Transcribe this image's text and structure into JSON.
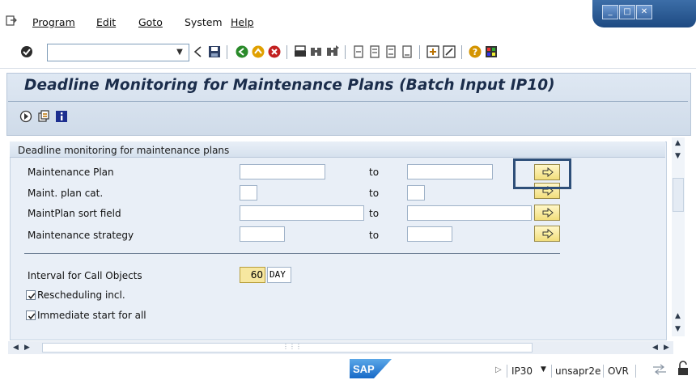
{
  "menu": {
    "items": [
      "Program",
      "Edit",
      "Goto",
      "System",
      "Help"
    ]
  },
  "toolbar": {
    "command_value": "",
    "icons": [
      "enter-icon",
      "back-icon",
      "save-icon",
      "back-green-icon",
      "exit-icon",
      "cancel-icon",
      "print-icon",
      "find-icon",
      "find-next-icon",
      "first-page-icon",
      "previous-page-icon",
      "next-page-icon",
      "last-page-icon",
      "create-session-icon",
      "shortcut-icon",
      "help-icon",
      "customize-layout-icon"
    ]
  },
  "title": {
    "text": "Deadline Monitoring for Maintenance Plans (Batch Input IP10)"
  },
  "app_toolbar": {
    "icons": [
      "execute-icon",
      "get-variant-icon",
      "info-icon"
    ]
  },
  "group": {
    "title": "Deadline monitoring for maintenance plans",
    "rows": [
      {
        "label": "Maintenance Plan",
        "from": "",
        "to_label": "to",
        "to": ""
      },
      {
        "label": "Maint. plan cat.",
        "from": "",
        "to_label": "to",
        "to": ""
      },
      {
        "label": "MaintPlan sort field",
        "from": "",
        "to_label": "to",
        "to": ""
      },
      {
        "label": "Maintenance strategy",
        "from": "",
        "to_label": "to",
        "to": ""
      }
    ],
    "interval": {
      "label": "Interval for Call Objects",
      "value": "60",
      "unit": "DAY"
    },
    "checkboxes": [
      {
        "label": "Rescheduling incl.",
        "checked": true
      },
      {
        "label": "Immediate start for all",
        "checked": true
      }
    ]
  },
  "status": {
    "logo": "SAP",
    "transaction": "IP30",
    "server": "unsapr2e",
    "mode": "OVR"
  },
  "colors": {
    "title_text": "#1b2d4b",
    "group_bg": "#e9eff7",
    "highlight_border": "#2e4f79",
    "multi_select_button": "#f2de7c"
  }
}
